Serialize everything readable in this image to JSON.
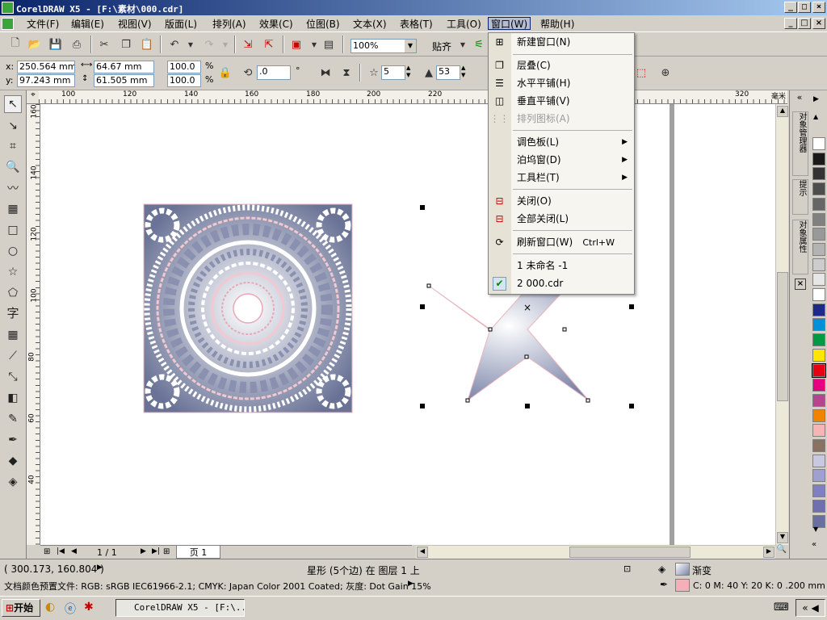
{
  "titlebar": {
    "title": "CorelDRAW X5 - [F:\\素材\\000.cdr]",
    "min": "_",
    "max": "□",
    "close": "×"
  },
  "menubar": {
    "items": [
      "文件(F)",
      "编辑(E)",
      "视图(V)",
      "版面(L)",
      "排列(A)",
      "效果(C)",
      "位图(B)",
      "文本(X)",
      "表格(T)",
      "工具(O)",
      "窗口(W)",
      "帮助(H)"
    ]
  },
  "toolbar": {
    "zoom": "100%",
    "snap_label": "贴齐"
  },
  "propbar": {
    "x_label": "x:",
    "x_value": "250.564 mm",
    "y_label": "y:",
    "y_value": "97.243 mm",
    "w_value": "64.67 mm",
    "h_value": "61.505 mm",
    "sx_value": "100.0",
    "sy_value": "100.0",
    "pct": "%",
    "angle_value": ".0",
    "deg": "°",
    "points_value": "5",
    "sharpness_value": "53"
  },
  "ruler": {
    "h_labels": [
      "100",
      "120",
      "140",
      "160",
      "180",
      "200",
      "220",
      "320",
      "毫米"
    ],
    "v_labels": [
      "160",
      "140",
      "120",
      "100",
      "80",
      "60",
      "40"
    ]
  },
  "toolbox_text_tool": "字",
  "window_menu": {
    "items": [
      {
        "label": "新建窗口(N)"
      },
      {
        "label": "层叠(C)"
      },
      {
        "label": "水平平铺(H)"
      },
      {
        "label": "垂直平铺(V)"
      },
      {
        "label": "排列图标(A)"
      },
      {
        "label": "调色板(L)"
      },
      {
        "label": "泊坞窗(D)"
      },
      {
        "label": "工具栏(T)"
      },
      {
        "label": "关闭(O)"
      },
      {
        "label": "全部关闭(L)"
      },
      {
        "label": "刷新窗口(W)",
        "shortcut": "Ctrl+W"
      },
      {
        "label": "1 未命名 -1"
      },
      {
        "label": "2 000.cdr"
      }
    ]
  },
  "dock_tabs": [
    "对象管理器",
    "提示",
    "对象属性"
  ],
  "pagenav": {
    "counter": "1 / 1",
    "page_tab": "页 1"
  },
  "status": {
    "coords": "( 300.173, 160.804 )",
    "selection": "星形 (5个边) 在 图层 1 上",
    "fill_label": "渐变",
    "outline_label": "C: 0 M: 40 Y: 20 K: 0  .200 mm",
    "profile": "文档颜色预置文件: RGB: sRGB IEC61966-2.1; CMYK: Japan Color 2001 Coated; 灰度: Dot Gain 15%"
  },
  "taskbar": {
    "start": "开始",
    "task": "CorelDRAW X5 - [F:\\..."
  },
  "palette": [
    "#ffffff",
    "#1a1a1a",
    "#333333",
    "#4d4d4d",
    "#666666",
    "#808080",
    "#999999",
    "#b3b3b3",
    "#cccccc",
    "#e6e6e6",
    "#ffffff",
    "#1e2a8a",
    "#0090d8",
    "#009a44",
    "#ffe600",
    "#e60012",
    "#e4007f",
    "#b5458e",
    "#f08300",
    "#f5b5b5",
    "#8a7262",
    "#c8c8e0",
    "#a0a0d0",
    "#8080c0",
    "#7070b0",
    "#6870a0"
  ]
}
